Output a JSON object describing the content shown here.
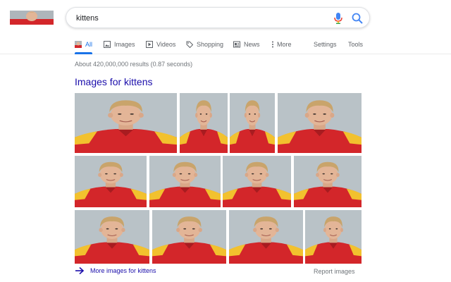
{
  "search": {
    "query": "kittens"
  },
  "tabs": [
    {
      "label": "All",
      "icon": "search-thumb-icon",
      "active": true
    },
    {
      "label": "Images",
      "icon": "image-icon"
    },
    {
      "label": "Videos",
      "icon": "video-icon"
    },
    {
      "label": "Shopping",
      "icon": "tag-icon"
    },
    {
      "label": "News",
      "icon": "news-icon"
    },
    {
      "label": "More",
      "icon": "more-vert-icon"
    },
    {
      "label": "Settings"
    },
    {
      "label": "Tools"
    }
  ],
  "results": {
    "stats": "About 420,000,000 results (0.87 seconds)"
  },
  "images_section": {
    "heading": "Images for kittens",
    "more_link": "More images for kittens",
    "report_link": "Report images",
    "thumbnail_count": 12
  },
  "colors": {
    "link": "#1a0dab",
    "accent": "#1a73e8",
    "jacket_red": "#d3262a",
    "jacket_yellow": "#f2c12e"
  }
}
